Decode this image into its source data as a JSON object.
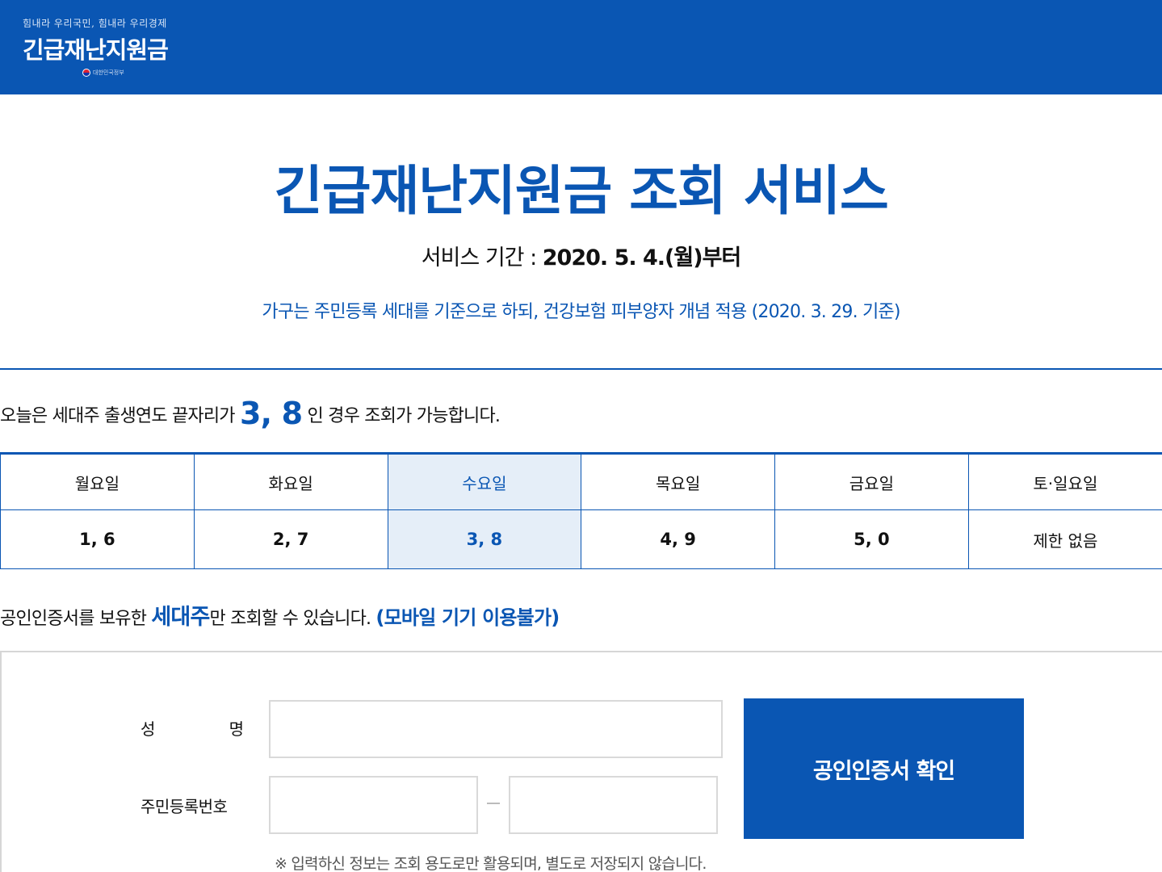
{
  "header": {
    "slogan": "힘내라 우리국민, 힘내라 우리경제",
    "logo_title": "긴급재난지원금",
    "ministry": "대한민국정부",
    "bg_color": "#0a56b3"
  },
  "main": {
    "title": "긴급재난지원금 조회 서비스",
    "period_label": "서비스 기간 : ",
    "period_value": "2020. 5. 4.(월)부터",
    "household_note": "가구는 주민등록 세대를 기준으로 하되, 건강보험 피부양자 개념 적용 (2020. 3. 29. 기준)"
  },
  "today": {
    "prefix": "오늘은 세대주 출생연도 끝자리가 ",
    "digits": "3, 8",
    "suffix": " 인 경우 조회가 가능합니다."
  },
  "schedule": {
    "days": [
      "월요일",
      "화요일",
      "수요일",
      "목요일",
      "금요일",
      "토·일요일"
    ],
    "digits": [
      "1, 6",
      "2, 7",
      "3, 8",
      "4, 9",
      "5, 0",
      "제한 없음"
    ],
    "active_day": "수요일"
  },
  "cert_note": {
    "prefix": "공인인증서를 보유한 ",
    "highlight": "세대주",
    "middle": "만 조회할 수 있습니다. ",
    "mobile": "(모바일 기기 이용불가)"
  },
  "form": {
    "name_label_first": "성",
    "name_label_second": "명",
    "rrn_label": "주민등록번호",
    "name_value": "",
    "rrn_front_value": "",
    "rrn_back_value": "",
    "cert_button": "공인인증서 확인",
    "privacy_note": "※ 입력하신 정보는 조회 용도로만 활용되며, 별도로 저장되지 않습니다."
  },
  "colors": {
    "accent": "#0a56b3",
    "active_cell_bg": "#e5eef8"
  }
}
